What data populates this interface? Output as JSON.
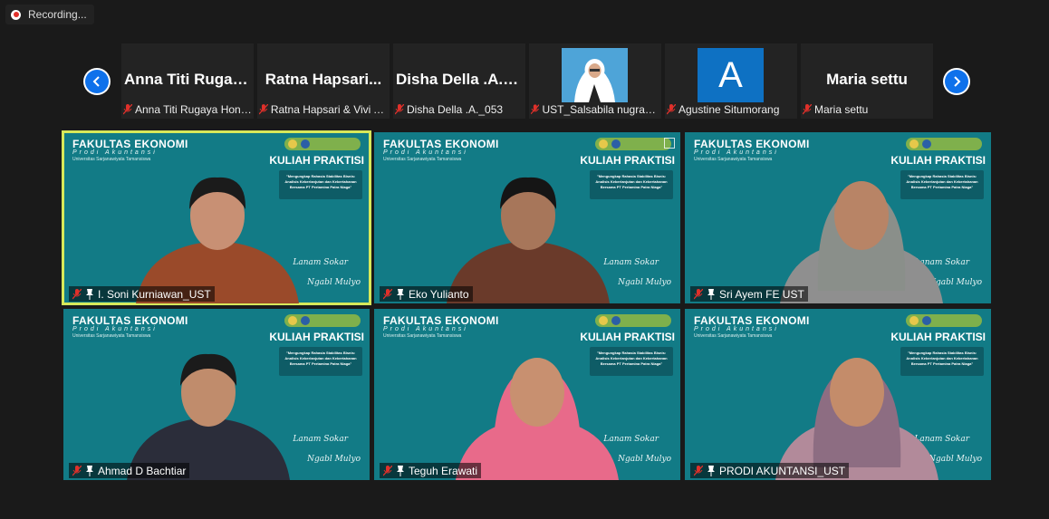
{
  "recording": {
    "label": "Recording..."
  },
  "filmstrip": [
    {
      "display_name": "Anna Titi Rugay...",
      "label": "Anna Titi Rugaya Honi...",
      "avatar": "none"
    },
    {
      "display_name": "Ratna Hapsari...",
      "label": "Ratna Hapsari & Vivi A...",
      "avatar": "none"
    },
    {
      "display_name": "Disha Della .A._...",
      "label": "Disha Della .A._053",
      "avatar": "none"
    },
    {
      "display_name": "",
      "label": "UST_Salsabila nugraha...",
      "avatar": "photo"
    },
    {
      "display_name": "",
      "label": "Agustine Situmorang",
      "avatar": "A"
    },
    {
      "display_name": "Maria settu",
      "label": "Maria settu",
      "avatar": "none"
    }
  ],
  "background": {
    "fakultas": "FAKULTAS EKONOMI",
    "prodi": "Prodi Akuntansi",
    "univ": "Universitas Sarjanawiyata Tamansiswa",
    "kuliah": "KULIAH PRAKTISI",
    "theme": "\"Mengungkap Rahasia Stabilitas Bisnis: Analisis Keberlanjutan dan Kebertahanan Bersama PT Pertamina Patra Niaga\"",
    "sign1": "Lanam Sokar",
    "sign2": "Ngabl Mulyo"
  },
  "tiles": [
    {
      "name": "I. Soni Kurniawan_UST",
      "active": true
    },
    {
      "name": "Eko Yulianto",
      "active": false
    },
    {
      "name": "Sri Ayem FE UST",
      "active": false
    },
    {
      "name": "Ahmad D Bachtiar",
      "active": false
    },
    {
      "name": "Teguh Erawati",
      "active": false
    },
    {
      "name": "PRODI AKUNTANSI_UST",
      "active": false
    }
  ],
  "icons": {
    "mic_muted_color": "#e0302a",
    "accent": "#0e71eb",
    "active_speaker": "#d7e85a"
  }
}
